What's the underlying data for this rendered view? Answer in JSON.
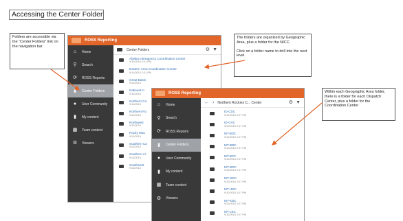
{
  "page": {
    "title": "Accessing the Center Folders"
  },
  "callouts": {
    "nav": "Folders are accessible via the “Center Folders” link on the navigation bar",
    "geo_1": "The folders are organized by Geographic Area, plus a folder for the NICC.",
    "geo_2": "Click on a folder name to drill into the next level.",
    "dispatch": "Within each Geographic Area folder, there is a folder for each Dispatch Center, plus a folder for the Coordination Center"
  },
  "app_name": "ROSS Reporting",
  "nav_items": [
    {
      "label": "Home",
      "icon": "home-icon"
    },
    {
      "label": "Search",
      "icon": "search-icon"
    },
    {
      "label": "ROSS Reports",
      "icon": "refresh-icon"
    },
    {
      "label": "Center Folders",
      "icon": "folder-icon"
    },
    {
      "label": "User Community",
      "icon": "users-icon"
    },
    {
      "label": "My content",
      "icon": "folder-icon"
    },
    {
      "label": "Team content",
      "icon": "team-icon"
    },
    {
      "label": "Viewers",
      "icon": "gear-icon"
    }
  ],
  "back_window": {
    "header": "Center Folders",
    "folders": [
      {
        "name": "Alaska Interagency Coordination Center",
        "date": "9/10/2016 2:01 PM"
      },
      {
        "name": "Eastern Area Coordination Center",
        "date": "9/10/2016 2:01 PM"
      },
      {
        "name": "Great Basin",
        "date": "9/10/2016"
      },
      {
        "name": "National In",
        "date": "9/10/2016"
      },
      {
        "name": "Northern Ca",
        "date": "9/10/2016"
      },
      {
        "name": "Northern Ro",
        "date": "9/10/2016"
      },
      {
        "name": "Northwest",
        "date": "9/10/2016"
      },
      {
        "name": "Rocky Mou",
        "date": "9/10/2016"
      },
      {
        "name": "Southern Ca",
        "date": "9/10/2016"
      },
      {
        "name": "Southern Ar",
        "date": "9/10/2016"
      },
      {
        "name": "Southwest",
        "date": "9/10/2016"
      }
    ]
  },
  "front_window": {
    "breadcrumb": "Northern Rockies C... Center",
    "folders": [
      {
        "name": "ID-CDC",
        "date": "9/10/2016 2:07 PM"
      },
      {
        "name": "ID-GVC",
        "date": "9/10/2016 2:07 PM"
      },
      {
        "name": "MT-BDC",
        "date": "9/10/2016 2:07 PM"
      },
      {
        "name": "MT-BRC",
        "date": "9/10/2016 2:07 PM"
      },
      {
        "name": "MT-BZC",
        "date": "9/10/2016 2:07 PM"
      },
      {
        "name": "MT-DDC",
        "date": "9/10/2016 2:07 PM"
      },
      {
        "name": "MT-GDC",
        "date": "9/10/2016 2:07 PM"
      },
      {
        "name": "MT-HDC",
        "date": "9/10/2016 2:07 PM"
      },
      {
        "name": "MT-KDC",
        "date": "9/10/2016 2:07 PM"
      },
      {
        "name": "MT-LEC",
        "date": "9/10/2016 2:07 PM"
      },
      {
        "name": "MT-MDC",
        "date": "9/10/2016 2:07 PM"
      }
    ]
  },
  "colors": {
    "accent": "#e2652a",
    "sidebar": "#393939",
    "active_nav": "#9fa3a8",
    "link": "#2f6fb3",
    "arrow": "#e2652a"
  }
}
